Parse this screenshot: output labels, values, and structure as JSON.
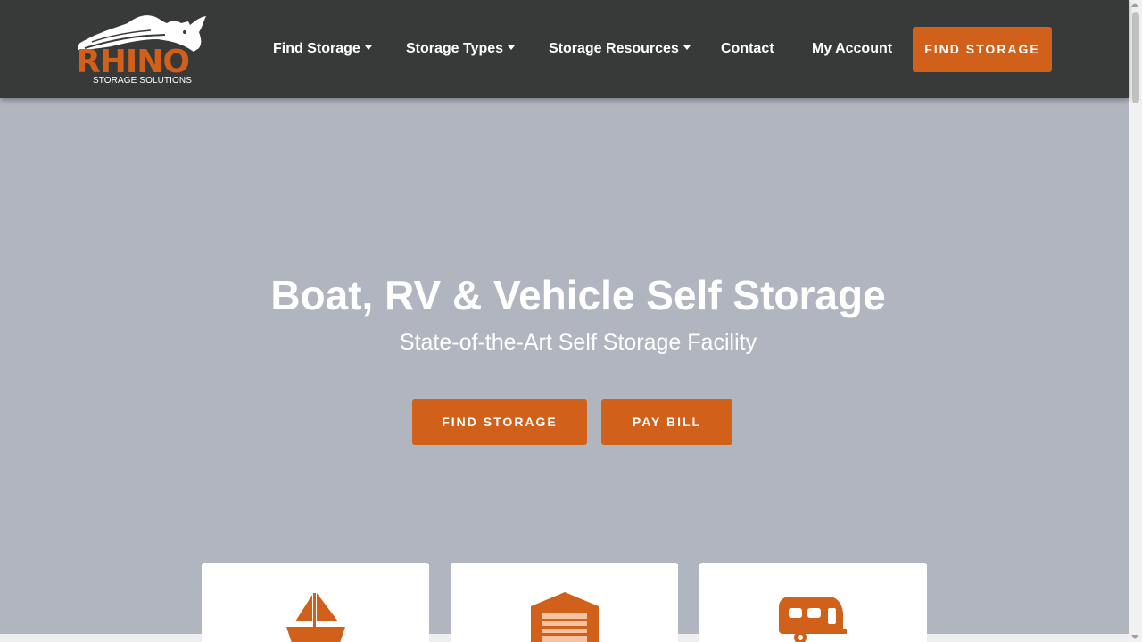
{
  "brand": {
    "name": "RHINO",
    "tagline": "STORAGE SOLUTIONS",
    "accent_color": "#d0601a",
    "nav_bg": "#383a39",
    "hero_bg": "#b1b5bf"
  },
  "nav": {
    "items": [
      {
        "label": "Find Storage",
        "dropdown": true
      },
      {
        "label": "Storage Types",
        "dropdown": true
      },
      {
        "label": "Storage Resources",
        "dropdown": true
      },
      {
        "label": "Contact",
        "dropdown": false
      },
      {
        "label": "My Account",
        "dropdown": false
      }
    ],
    "cta_label": "FIND STORAGE"
  },
  "hero": {
    "title": "Boat, RV & Vehicle Self Storage",
    "subtitle": "State-of-the-Art Self Storage Facility",
    "primary_button": "FIND STORAGE",
    "secondary_button": "PAY BILL"
  },
  "cards": [
    {
      "icon": "sailboat-icon"
    },
    {
      "icon": "storage-unit-icon"
    },
    {
      "icon": "camper-trailer-icon"
    }
  ]
}
